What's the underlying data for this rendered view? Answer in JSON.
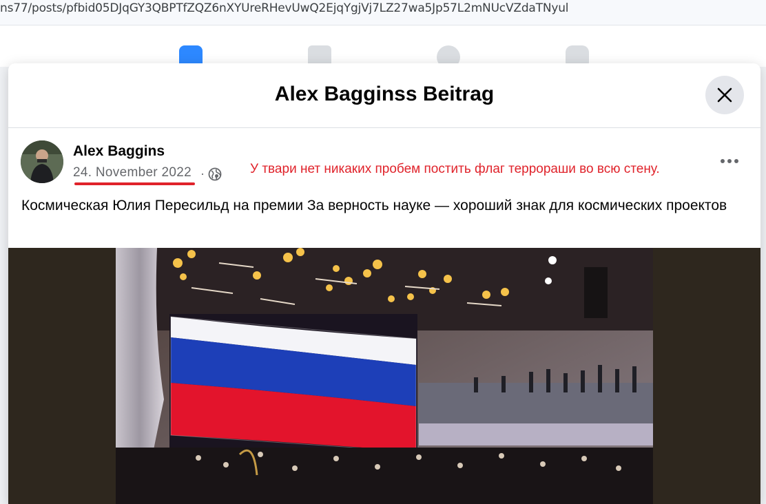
{
  "browser": {
    "url": "ns77/posts/pfbid05DJqGY3QBPTfZQZ6nXYUreRHevUwQ2EjqYgjVj7LZ27wa5Jp57L2mNUcVZdaTNyul"
  },
  "nav": {
    "icons": [
      "home-icon",
      "marketplace-icon",
      "groups-icon",
      "gaming-icon"
    ],
    "accent": "#2d88ff"
  },
  "modal": {
    "title": "Alex Bagginss Beitrag",
    "close_icon": "close-icon"
  },
  "post": {
    "author": "Alex Baggins",
    "date": "24. November 2022",
    "separator": "·",
    "audience_icon": "globe-icon",
    "text": "Космическая Юлия Пересильд на премии За верность науке — хороший знак для космических проектов",
    "more_icon": "more-options-icon"
  },
  "annotation": {
    "text": "У твари нет никаких пробем постить флаг террораши во всю стену.",
    "color": "#e0232b"
  },
  "photo": {
    "subject": "concert hall with flag on screen",
    "flag_colors": [
      "#ffffff",
      "#1d3fb8",
      "#e3142c"
    ]
  }
}
